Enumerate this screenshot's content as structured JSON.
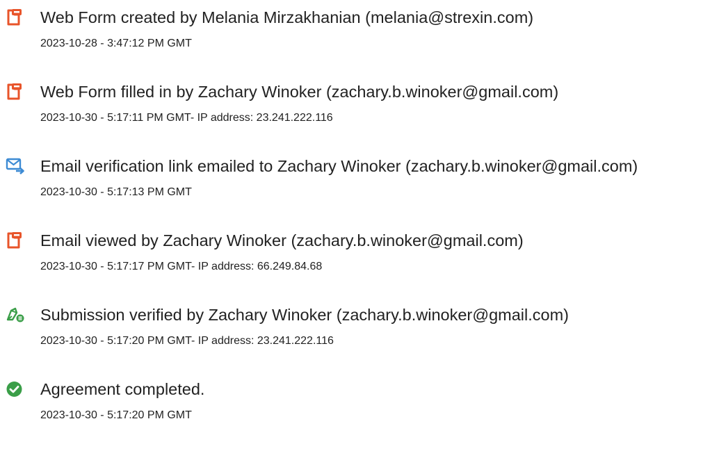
{
  "events": [
    {
      "icon": "pdf-document-icon",
      "title": "Web Form created by Melania Mirzakhanian (melania@strexin.com)",
      "meta": "2023-10-28 - 3:47:12 PM GMT"
    },
    {
      "icon": "pdf-document-icon",
      "title": "Web Form filled in by Zachary Winoker (zachary.b.winoker@gmail.com)",
      "meta": "2023-10-30 - 5:17:11 PM GMT- IP address: 23.241.222.116"
    },
    {
      "icon": "email-send-icon",
      "title": "Email verification link emailed to Zachary Winoker (zachary.b.winoker@gmail.com)",
      "meta": "2023-10-30 - 5:17:13 PM GMT"
    },
    {
      "icon": "pdf-document-icon",
      "title": "Email viewed by Zachary Winoker (zachary.b.winoker@gmail.com)",
      "meta": "2023-10-30 - 5:17:17 PM GMT- IP address: 66.249.84.68"
    },
    {
      "icon": "pen-verified-icon",
      "title": "Submission verified by Zachary Winoker (zachary.b.winoker@gmail.com)",
      "meta": "2023-10-30 - 5:17:20 PM GMT- IP address: 23.241.222.116"
    },
    {
      "icon": "checkmark-circle-icon",
      "title": "Agreement completed.",
      "meta": "2023-10-30 - 5:17:20 PM GMT"
    }
  ],
  "colors": {
    "pdf_icon": "#e8542a",
    "email_icon": "#3d8bd4",
    "pen_icon": "#3a9e48",
    "check_icon": "#3a9e48",
    "text": "#222222"
  }
}
